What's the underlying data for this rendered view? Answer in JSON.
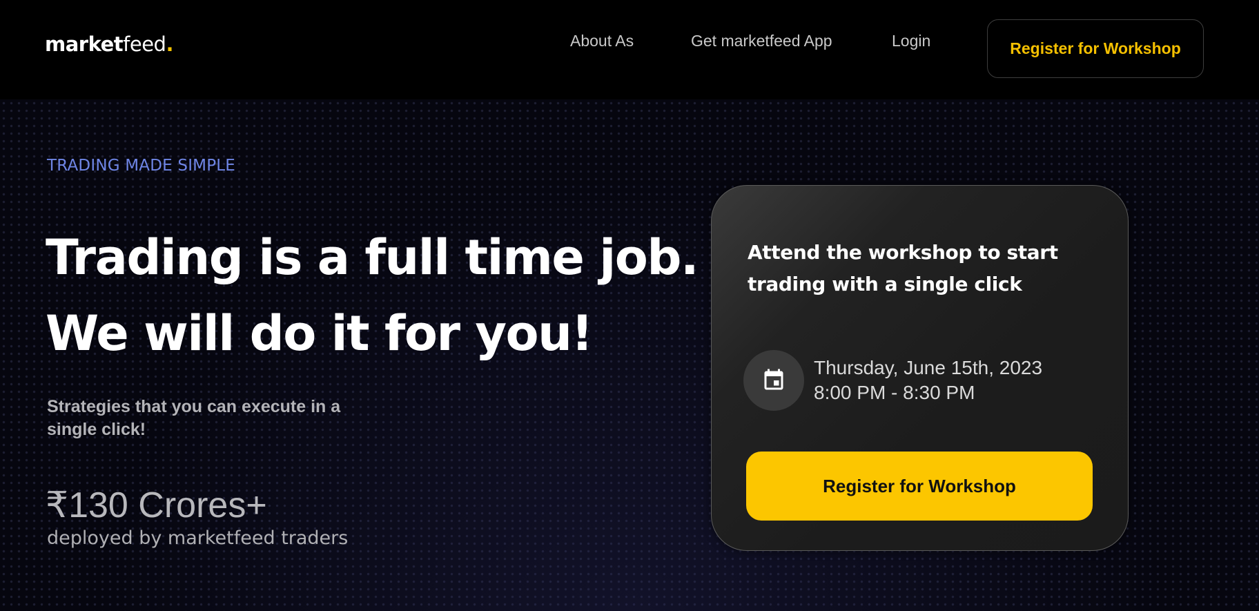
{
  "header": {
    "logo": {
      "bold": "market",
      "regular": "feed",
      "dot": "."
    },
    "nav": [
      {
        "label": "About As"
      },
      {
        "label": "Get marketfeed App"
      },
      {
        "label": "Login"
      }
    ],
    "cta_label": "Register for Workshop"
  },
  "hero": {
    "eyebrow": "TRADING MADE SIMPLE",
    "headline_line1": "Trading is a full time job.",
    "headline_line2": "We will do it for you!",
    "subtext": "Strategies that you can execute in a single click!",
    "stat_value": "₹130 Crores+",
    "stat_label": "deployed by marketfeed traders"
  },
  "card": {
    "title": "Attend the workshop to start trading with a single click",
    "icon": "calendar-icon",
    "date": "Thursday, June 15th, 2023",
    "time": "8:00 PM - 8:30 PM",
    "cta_label": "Register for Workshop"
  },
  "colors": {
    "accent": "#fcc600",
    "eyebrow": "#6f86e6",
    "background": "#000000"
  }
}
